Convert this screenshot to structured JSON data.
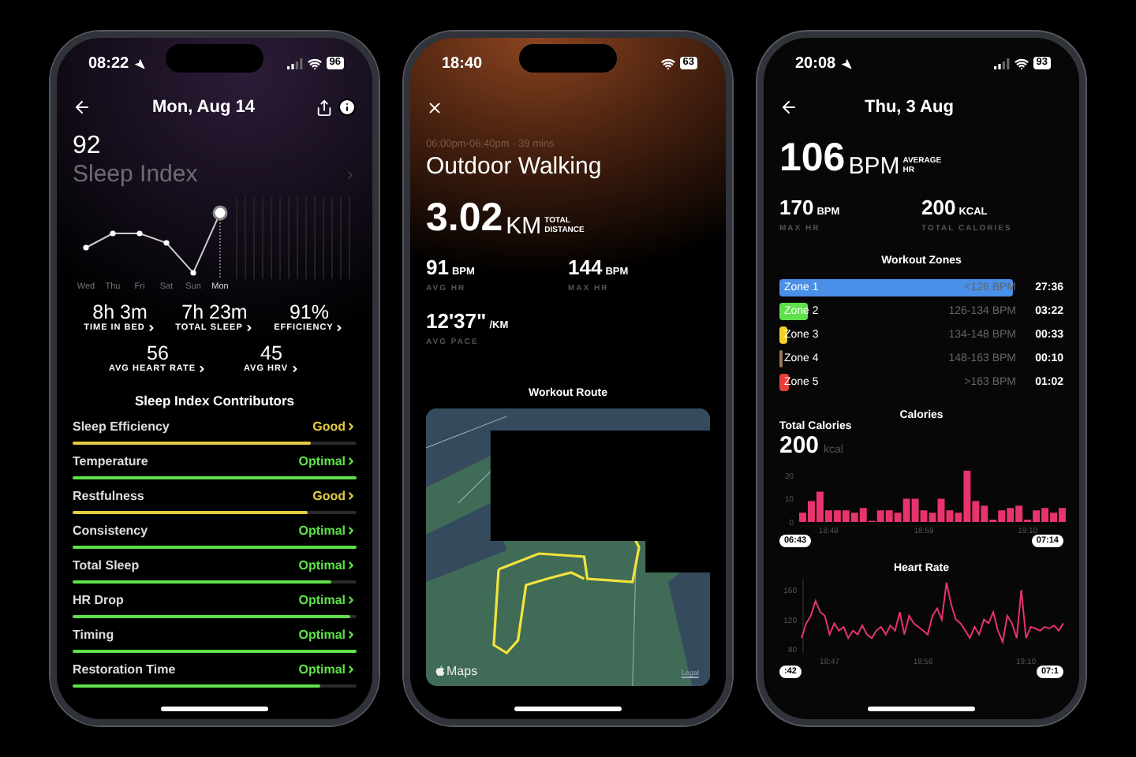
{
  "sleep_screen": {
    "status_bar": {
      "time": "08:22",
      "battery": "96",
      "location_arrow": true,
      "signal": true
    },
    "date": "Mon, Aug 14",
    "score": "92",
    "score_label": "Sleep Index",
    "days": [
      {
        "label": "Wed",
        "selected": false
      },
      {
        "label": "Thu",
        "selected": false
      },
      {
        "label": "Fri",
        "selected": false
      },
      {
        "label": "Sat",
        "selected": false
      },
      {
        "label": "Sun",
        "selected": false
      },
      {
        "label": "Mon",
        "selected": true
      }
    ],
    "metrics": [
      {
        "value": "8h 3m",
        "label": "TIME IN BED"
      },
      {
        "value": "7h 23m",
        "label": "TOTAL SLEEP"
      },
      {
        "value": "91%",
        "label": "EFFICIENCY"
      },
      {
        "value": "56",
        "label": "AVG HEART RATE"
      },
      {
        "value": "45",
        "label": "AVG HRV"
      }
    ],
    "contributors_title": "Sleep Index Contributors",
    "contributors": [
      {
        "name": "Sleep Efficiency",
        "rating": "Good",
        "color": "#e3cc45",
        "level": 0.84
      },
      {
        "name": "Temperature",
        "rating": "Optimal",
        "color": "#5fe04a",
        "level": 1
      },
      {
        "name": "Restfulness",
        "rating": "Good",
        "color": "#e3cc45",
        "level": 0.83
      },
      {
        "name": "Consistency",
        "rating": "Optimal",
        "color": "#5fe04a",
        "level": 1
      },
      {
        "name": "Total Sleep",
        "rating": "Optimal",
        "color": "#5fe04a",
        "level": 0.91
      },
      {
        "name": "HR Drop",
        "rating": "Optimal",
        "color": "#5fe04a",
        "level": 0.98
      },
      {
        "name": "Timing",
        "rating": "Optimal",
        "color": "#5fe04a",
        "level": 1
      },
      {
        "name": "Restoration Time",
        "rating": "Optimal",
        "color": "#5fe04a",
        "level": 0.87
      }
    ]
  },
  "walking_screen": {
    "status_bar": {
      "time": "18:40",
      "battery": "63"
    },
    "time_range": "06:00pm-06:40pm · 39 mins",
    "title": "Outdoor Walking",
    "distance": {
      "value": "3.02",
      "unit": "KM",
      "label": "TOTAL DISTANCE"
    },
    "stats": [
      {
        "value": "91",
        "unit": "BPM",
        "label": "AVG HR"
      },
      {
        "value": "144",
        "unit": "BPM",
        "label": "MAX HR"
      },
      {
        "value": "12'37\"",
        "unit": "/KM",
        "label": "AVG PACE"
      }
    ],
    "route_title": "Workout Route",
    "map": {
      "kind": "picture",
      "brand": "Maps",
      "legal": "Legal"
    }
  },
  "heart_rate_screen": {
    "status_bar": {
      "time": "20:08",
      "battery": "93",
      "location_arrow": true,
      "signal": true
    },
    "date": "Thu, 3 Aug",
    "average": {
      "value": "106",
      "unit": "BPM",
      "label": "AVERAGE HR"
    },
    "stats": [
      {
        "value": "170",
        "unit": "BPM",
        "label": "MAX HR"
      },
      {
        "value": "200",
        "unit": "KCAL",
        "label": "TOTAL CALORIES"
      }
    ],
    "zones_title": "Workout Zones",
    "zones": [
      {
        "name": "Zone 1",
        "range": "<126 BPM",
        "time": "27:36",
        "color": "#4a8fe8"
      },
      {
        "name": "Zone 2",
        "range": "126-134 BPM",
        "time": "03:22",
        "color": "#5ee04a"
      },
      {
        "name": "Zone 3",
        "range": "134-148 BPM",
        "time": "00:33",
        "color": "#f2d12a"
      },
      {
        "name": "Zone 4",
        "range": "148-163 BPM",
        "time": "00:10",
        "color": "#9a7a55"
      },
      {
        "name": "Zone 5",
        "range": ">163 BPM",
        "time": "01:02",
        "color": "#e8403a"
      }
    ],
    "calories": {
      "title": "Calories",
      "total_label": "Total Calories",
      "total": "200",
      "unit": "kcal",
      "range_start": "06:43",
      "range_end": "07:14",
      "chart_data": {
        "type": "bar",
        "categories": [
          null,
          null,
          null,
          "18:48",
          null,
          null,
          null,
          null,
          null,
          null,
          null,
          null,
          null,
          null,
          "18:59",
          null,
          null,
          null,
          null,
          null,
          null,
          null,
          null,
          null,
          null,
          null,
          "19:10",
          null,
          null,
          null,
          null
        ],
        "series": [
          {
            "color": "#e8336d",
            "values": [
              4,
              9,
              13,
              5,
              5,
              5,
              4,
              6,
              0.5,
              5,
              5,
              4,
              10,
              10,
              5,
              4,
              10,
              5,
              4,
              22,
              9,
              7,
              1,
              5,
              6,
              7,
              1,
              5,
              6,
              4,
              6
            ]
          }
        ],
        "ylim": [
          0,
          25
        ],
        "yticks": [
          0,
          10,
          20
        ]
      }
    },
    "heart_rate": {
      "title": "Heart Rate",
      "range_start": ":42",
      "range_end": "07:1",
      "chart_data": {
        "type": "line",
        "categories": [
          null,
          null,
          null,
          null,
          null,
          null,
          "18:47",
          null,
          null,
          null,
          null,
          null,
          null,
          null,
          null,
          null,
          null,
          null,
          null,
          null,
          null,
          null,
          null,
          null,
          null,
          null,
          "18:58",
          null,
          null,
          null,
          null,
          null,
          null,
          null,
          null,
          null,
          null,
          null,
          null,
          null,
          null,
          null,
          null,
          null,
          null,
          null,
          null,
          null,
          "19:10",
          null,
          null,
          null,
          null,
          null,
          null,
          null,
          null
        ],
        "series": [
          {
            "color": "#e8336d",
            "values": [
              95,
              115,
              125,
              145,
              130,
              125,
              100,
              115,
              105,
              110,
              95,
              105,
              100,
              112,
              100,
              95,
              105,
              110,
              100,
              112,
              105,
              130,
              100,
              125,
              115,
              110,
              105,
              100,
              125,
              135,
              120,
              170,
              140,
              120,
              115,
              105,
              95,
              110,
              100,
              120,
              115,
              130,
              105,
              90,
              125,
              115,
              95,
              160,
              95,
              110,
              108,
              105,
              110,
              108,
              112,
              105,
              115
            ]
          }
        ],
        "ylim": [
          75,
          175
        ],
        "yticks": [
          80,
          120,
          160
        ]
      }
    }
  }
}
